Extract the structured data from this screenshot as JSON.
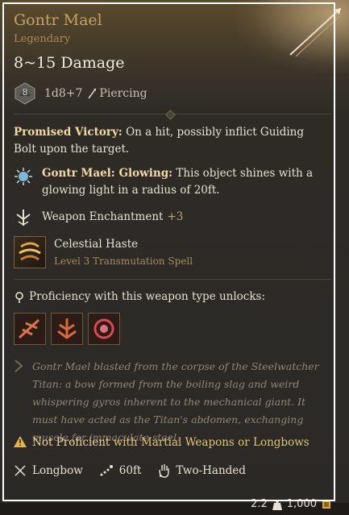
{
  "item": {
    "name": "Gontr Mael",
    "rarity": "Legendary",
    "damage": "8~15 Damage",
    "die_label": "8",
    "dice_roll": "1d8+7",
    "damage_type": "Piercing"
  },
  "passive": {
    "name": "Promised Victory:",
    "text": " On a hit, possibly inflict Guiding Bolt upon the target."
  },
  "glowing": {
    "name": "Gontr Mael: Glowing:",
    "text": " This object shines with a glowing light in a radius of 20ft."
  },
  "enchantment": {
    "label": "Weapon Enchantment",
    "value": "+3"
  },
  "spell": {
    "name": "Celestial Haste",
    "subtitle": "Level 3 Transmutation Spell"
  },
  "proficiency": {
    "heading": "Proficiency with this weapon type unlocks:",
    "icons": [
      "piercing-shot-icon",
      "brace-ranged-icon",
      "mobile-shot-icon"
    ]
  },
  "lore": "Gontr Mael blasted from the corpse of the Steelwatcher Titan: a bow formed from the boiling slag and weird whispering gyros inherent to the mechanical giant. It must have acted as the Titan's abdomen, exchanging muscle for immaculate steel.",
  "warning": {
    "not_proficient": "Not Proficient",
    "rest": " with Martial Weapons or Longbows"
  },
  "traits": {
    "type": "Longbow",
    "range": "60ft",
    "handedness": "Two-Handed"
  },
  "footer": {
    "weight": "2.2",
    "value": "1,000"
  },
  "colors": {
    "title": "#c5a26a",
    "rarity": "#a58a55",
    "warning": "#e3c27a"
  }
}
